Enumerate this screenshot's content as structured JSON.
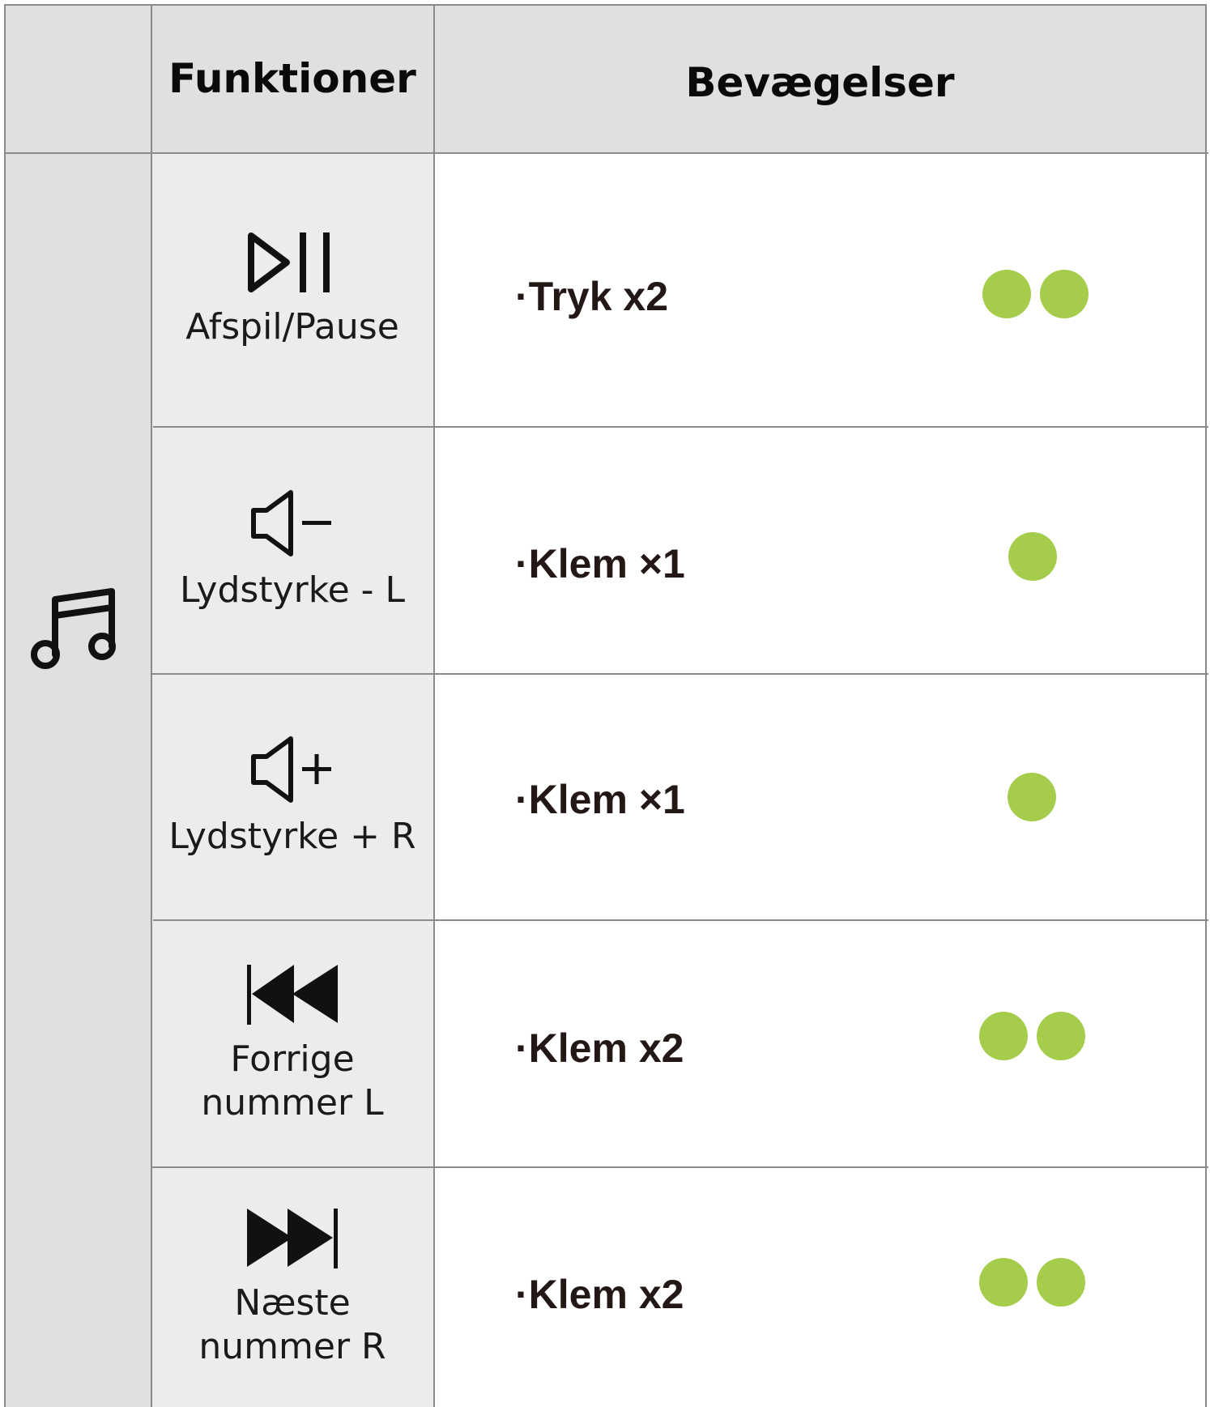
{
  "header": {
    "functions_label": "Funktioner",
    "gestures_label": "Bevægelser"
  },
  "category_icon": "music-note-icon",
  "indicator_color": "#a5cd4b",
  "rows": [
    {
      "icon": "play-pause-icon",
      "function_label": "Afspil/Pause",
      "gesture": "Tryk x2",
      "dots": 2
    },
    {
      "icon": "volume-down-icon",
      "function_label": "Lydstyrke - L",
      "gesture": "Klem ×1",
      "dots": 1
    },
    {
      "icon": "volume-up-icon",
      "function_label": "Lydstyrke + R",
      "gesture": "Klem ×1",
      "dots": 1
    },
    {
      "icon": "previous-track-icon",
      "function_label": "Forrige\nnummer L",
      "gesture": "Klem x2",
      "dots": 2
    },
    {
      "icon": "next-track-icon",
      "function_label": "Næste\nnummer R",
      "gesture": "Klem x2",
      "dots": 2
    }
  ]
}
